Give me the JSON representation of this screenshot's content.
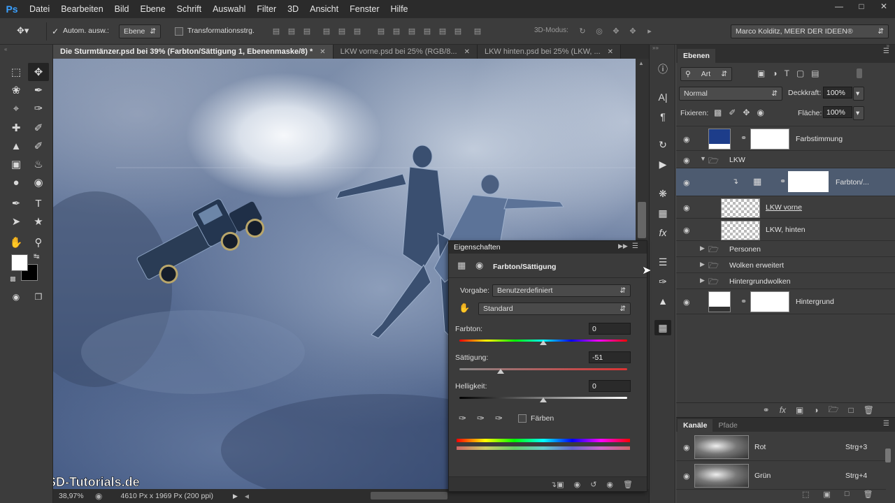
{
  "menu": {
    "logo": "Ps",
    "items": [
      "Datei",
      "Bearbeiten",
      "Bild",
      "Ebene",
      "Schrift",
      "Auswahl",
      "Filter",
      "3D",
      "Ansicht",
      "Fenster",
      "Hilfe"
    ]
  },
  "options_bar": {
    "auto_select_label": "Autom. ausw.:",
    "auto_select_value": "Ebene",
    "transform_label": "Transformationsstrg.",
    "mode_3d_label": "3D-Modus:",
    "workspace": "Marco Kolditz, MEER DER IDEEN®"
  },
  "doc_tabs": [
    {
      "label": "Die Sturmtänzer.psd bei 39% (Farbton/Sättigung 1, Ebenenmaske/8) *"
    },
    {
      "label": "LKW vorne.psd bei 25% (RGB/8..."
    },
    {
      "label": "LKW hinten.psd bei 25% (LKW, ..."
    }
  ],
  "status": {
    "zoom": "38,97%",
    "doc_info": "4610 Px x 1969 Px (200 ppi)"
  },
  "watermark": "PSD-Tutorials.de",
  "layers_panel": {
    "tab": "Ebenen",
    "filter_kind": "Art",
    "blend_mode": "Normal",
    "opacity_label": "Deckkraft:",
    "opacity_value": "100%",
    "lock_label": "Fixieren:",
    "fill_label": "Fläche:",
    "fill_value": "100%",
    "layers": [
      {
        "name": "Farbstimmung"
      },
      {
        "name": "LKW"
      },
      {
        "name": "Farbton/..."
      },
      {
        "name": "LKW vorne"
      },
      {
        "name": "LKW, hinten"
      },
      {
        "name": "Personen"
      },
      {
        "name": "Wolken erweitert"
      },
      {
        "name": "Hintergrundwolken"
      },
      {
        "name": "Hintergrund"
      }
    ]
  },
  "channels_panel": {
    "tabs": [
      "Kanäle",
      "Pfade"
    ],
    "channels": [
      {
        "name": "Rot",
        "shortcut": "Strg+3"
      },
      {
        "name": "Grün",
        "shortcut": "Strg+4"
      }
    ]
  },
  "properties": {
    "title": "Eigenschaften",
    "subtitle": "Farbton/Sättigung",
    "preset_label": "Vorgabe:",
    "preset_value": "Benutzerdefiniert",
    "range_value": "Standard",
    "hue_label": "Farbton:",
    "hue_value": "0",
    "saturation_label": "Sättigung:",
    "saturation_value": "-51",
    "lightness_label": "Helligkeit:",
    "lightness_value": "0",
    "colorize_label": "Färben",
    "hue_fraction": 0.5,
    "saturation_fraction": 0.245,
    "lightness_fraction": 0.5
  }
}
